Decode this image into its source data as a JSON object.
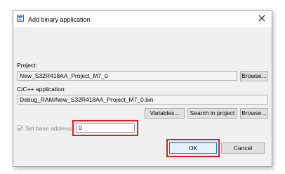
{
  "window": {
    "title": "Add binary application",
    "close_glyph": "close-icon"
  },
  "project": {
    "label": "Project:",
    "value": "New_S32R418AA_Project_M7_0",
    "browse_label": "Browse..."
  },
  "application": {
    "label": "C/C++ application:",
    "value": "Debug_RAM/New_S32R418AA_Project_M7_0.bin",
    "variables_label": "Variables...",
    "search_label": "Search in project",
    "browse_label": "Browse..."
  },
  "base_address": {
    "label": "Set base address:",
    "checked": true,
    "value": "0"
  },
  "buttons": {
    "ok_label": "OK",
    "cancel_label": "Cancel"
  },
  "colors": {
    "highlight": "#e01b24",
    "dialog_bg": "#f0f0f0"
  }
}
